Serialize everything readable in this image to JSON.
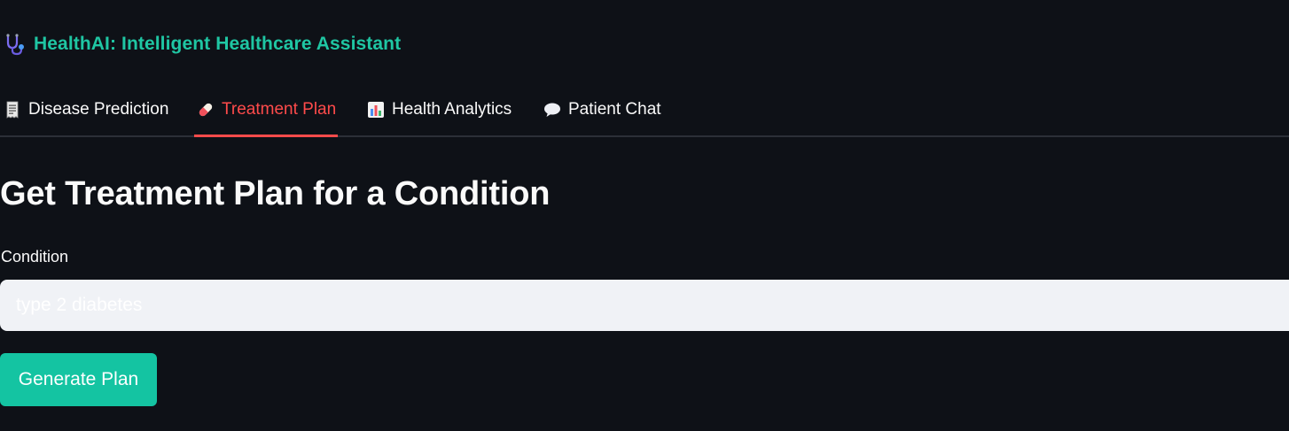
{
  "header": {
    "icon": "stethoscope-icon",
    "title": "HealthAI: Intelligent Healthcare Assistant",
    "title_color": "#1fc6a3"
  },
  "tabs": [
    {
      "icon": "receipt-icon",
      "label": "Disease Prediction",
      "active": false
    },
    {
      "icon": "pill-icon",
      "label": "Treatment Plan",
      "active": true
    },
    {
      "icon": "bar-chart-icon",
      "label": "Health Analytics",
      "active": false
    },
    {
      "icon": "speech-bubble-icon",
      "label": "Patient Chat",
      "active": false
    }
  ],
  "main": {
    "heading": "Get Treatment Plan for a Condition",
    "condition_field": {
      "label": "Condition",
      "value": "",
      "placeholder": "type 2 diabetes"
    },
    "generate_button_label": "Generate Plan"
  },
  "colors": {
    "background": "#0e1117",
    "accent_active_tab": "#ff4b4b",
    "button": "#14c4a2",
    "input_background": "#f0f2f6"
  }
}
